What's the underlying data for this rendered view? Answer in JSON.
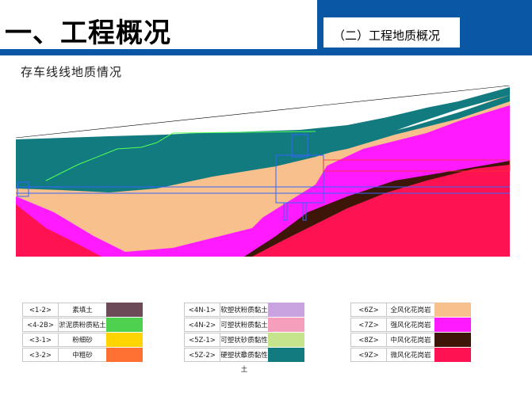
{
  "header": {
    "title": "一、工程概况",
    "section": "（二）工程地质概况"
  },
  "subtitle": "存车线线地质情况",
  "colors": {
    "header_blue": "#0a57a6",
    "teal": "#127b7f",
    "tan": "#f7c08d",
    "magenta": "#ff1aff",
    "crimson": "#ff1251",
    "darkbrown": "#3d1608",
    "tunnel_line": "#3366ff",
    "green_line": "#55ff55"
  },
  "legend": {
    "col1": [
      {
        "code": "<1-2>",
        "name": "素填土",
        "color": "#6c4a57"
      },
      {
        "code": "<4-2B>",
        "name": "淤泥质粉质粘土",
        "color": "#4ed14e"
      },
      {
        "code": "<3-1>",
        "name": "粉细砂",
        "color": "#ffd400"
      },
      {
        "code": "<3-2>",
        "name": "中粗砂",
        "color": "#ff7033"
      }
    ],
    "col2": [
      {
        "code": "<4N-1>",
        "name": "软塑状粉质黏土",
        "color": "#c9a3e0"
      },
      {
        "code": "<4N-2>",
        "name": "可塑状粉质黏土",
        "color": "#f59fbc"
      },
      {
        "code": "<5Z-1>",
        "name": "可塑状砂质黏性土",
        "color": "#c5e48c"
      },
      {
        "code": "<5Z-2>",
        "name": "硬塑状砂质黏性土",
        "color": "#127b7f"
      }
    ],
    "col3": [
      {
        "code": "<6Z>",
        "name": "全风化花岗岩",
        "color": "#f7c08d"
      },
      {
        "code": "<7Z>",
        "name": "强风化花岗岩",
        "color": "#ff1aff"
      },
      {
        "code": "<8Z>",
        "name": "中风化花岗岩",
        "color": "#3d1608"
      },
      {
        "code": "<9Z>",
        "name": "微风化花岗岩",
        "color": "#ff1251"
      }
    ]
  }
}
